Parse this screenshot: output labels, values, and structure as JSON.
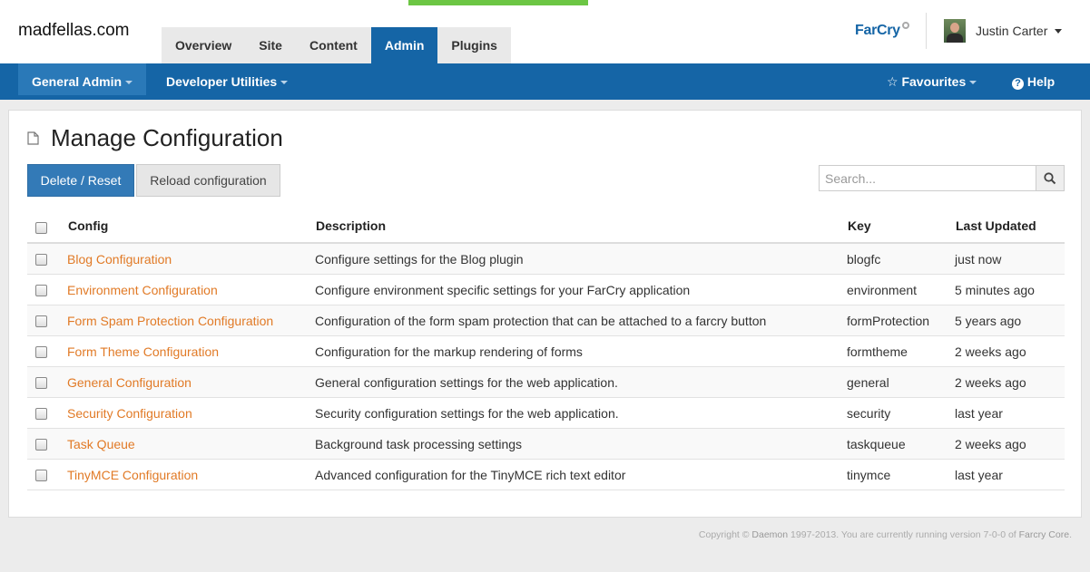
{
  "header": {
    "site_title": "madfellas.com",
    "tabs": [
      {
        "label": "Overview",
        "active": false
      },
      {
        "label": "Site",
        "active": false
      },
      {
        "label": "Content",
        "active": false
      },
      {
        "label": "Admin",
        "active": true
      },
      {
        "label": "Plugins",
        "active": false
      }
    ],
    "logo": "FarCry",
    "user_name": "Justin Carter"
  },
  "navbar": {
    "items": [
      {
        "label": "General Admin",
        "icon": "caret-down-icon"
      },
      {
        "label": "Developer Utilities",
        "icon": "caret-down-icon"
      }
    ],
    "right": [
      {
        "label": "Favourites",
        "icon": "star-icon"
      },
      {
        "label": "Help",
        "icon": "question-circle-icon"
      }
    ]
  },
  "page": {
    "title": "Manage Configuration",
    "title_icon": "document-icon",
    "delete_label": "Delete / Reset",
    "reload_label": "Reload configuration",
    "search_placeholder": "Search...",
    "search_icon": "search-icon"
  },
  "table": {
    "headers": [
      "Config",
      "Description",
      "Key",
      "Last Updated"
    ],
    "rows": [
      {
        "config": "Blog Configuration",
        "description": "Configure settings for the Blog plugin",
        "key": "blogfc",
        "updated": "just now"
      },
      {
        "config": "Environment Configuration",
        "description": "Configure environment specific settings for your FarCry application",
        "key": "environment",
        "updated": "5 minutes ago"
      },
      {
        "config": "Form Spam Protection Configuration",
        "description": "Configuration of the form spam protection that can be attached to a farcry button",
        "key": "formProtection",
        "updated": "5 years ago"
      },
      {
        "config": "Form Theme Configuration",
        "description": "Configuration for the markup rendering of forms",
        "key": "formtheme",
        "updated": "2 weeks ago"
      },
      {
        "config": "General Configuration",
        "description": "General configuration settings for the web application.",
        "key": "general",
        "updated": "2 weeks ago"
      },
      {
        "config": "Security Configuration",
        "description": "Security configuration settings for the web application.",
        "key": "security",
        "updated": "last year"
      },
      {
        "config": "Task Queue",
        "description": "Background task processing settings",
        "key": "taskqueue",
        "updated": "2 weeks ago"
      },
      {
        "config": "TinyMCE Configuration",
        "description": "Advanced configuration for the TinyMCE rich text editor",
        "key": "tinymce",
        "updated": "last year"
      }
    ]
  },
  "footer": {
    "prefix": "Copyright ©",
    "company": "Daemon",
    "middle": "1997-2013. You are currently running version 7-0-0 of",
    "product": "Farcry Core",
    "suffix": "."
  },
  "colors": {
    "brand_blue": "#1565a6",
    "link_orange": "#e17a26",
    "progress_green": "#6cc644"
  }
}
